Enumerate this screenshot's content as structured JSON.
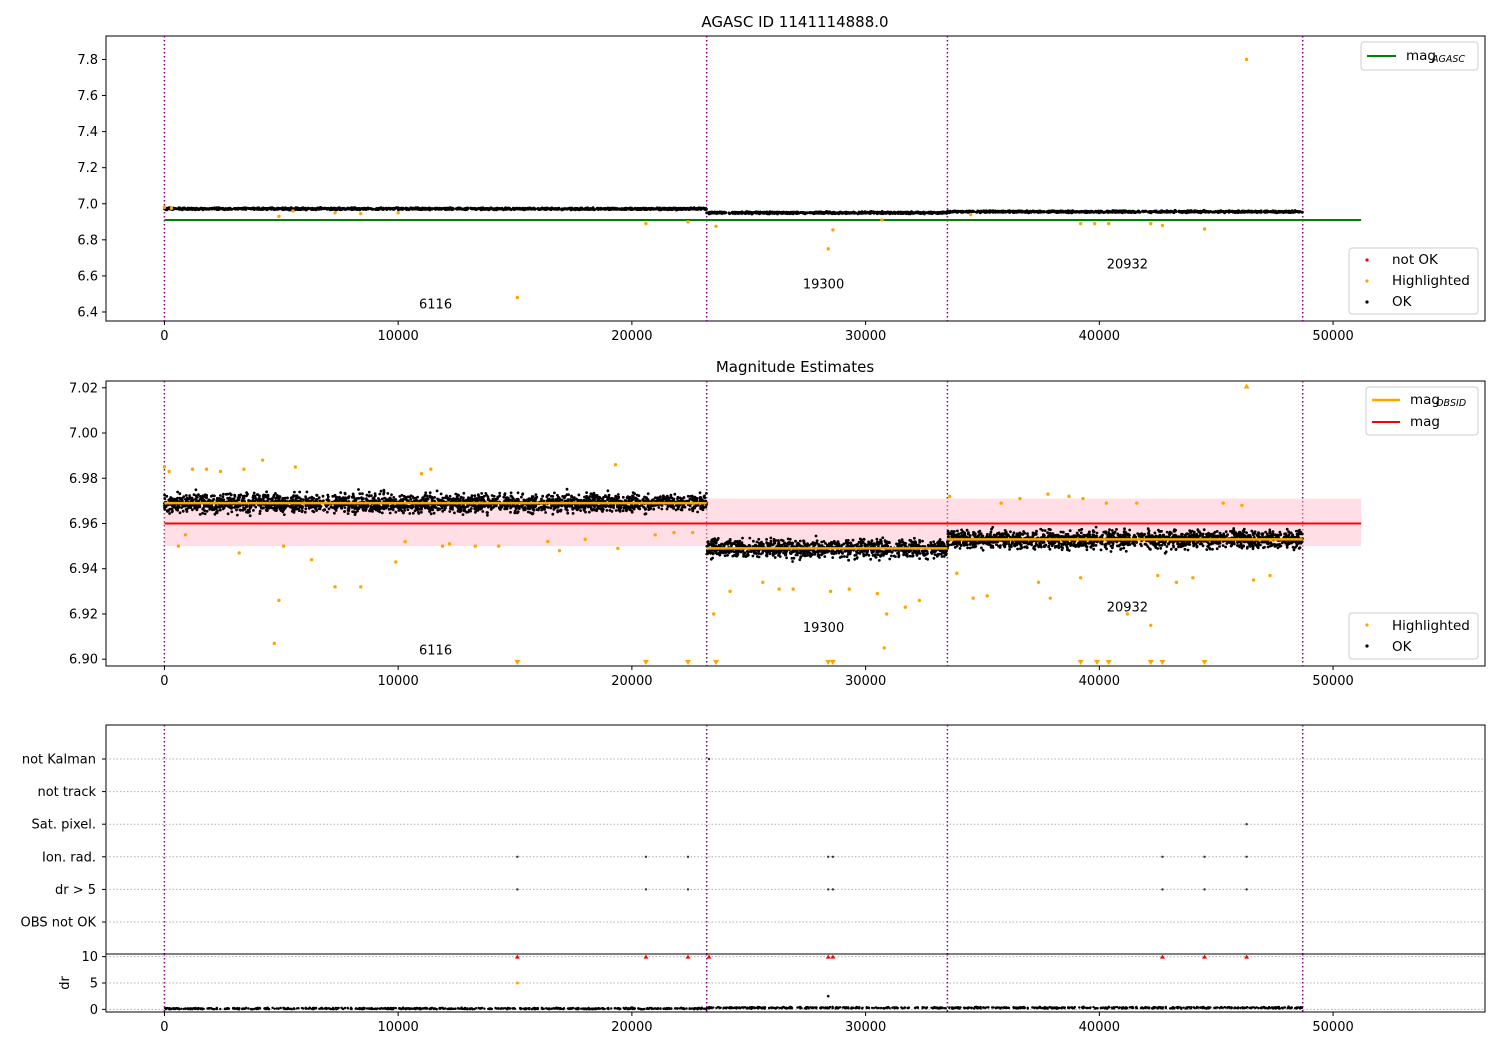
{
  "figure": {
    "panel1_title": "AGASC ID 1141114888.0",
    "panel2_title": "Magnitude Estimates"
  },
  "legends": {
    "mag_agasc": "mag",
    "mag_agasc_sub": "AGASC",
    "mag_obsid": "mag",
    "mag_obsid_sub": "OBSID",
    "mag": "mag",
    "not_ok": "not OK",
    "highlighted": "Highlighted",
    "ok": "OK"
  },
  "colors": {
    "ok": "#000000",
    "highlighted": "#ffa500",
    "not_ok": "#ff0000",
    "mag_agasc_line": "#008000",
    "mag_line": "#ff0000",
    "mag_band": "#ffc0cb",
    "obsid_line": "#ffa500",
    "obsid_boundary": "#800080"
  },
  "chart_data": [
    {
      "type": "scatter",
      "title": "AGASC ID 1141114888.0",
      "xlim": [
        -2500,
        56500
      ],
      "ylim": [
        6.35,
        7.93
      ],
      "xticks": [
        0,
        10000,
        20000,
        30000,
        40000,
        50000
      ],
      "yticks": [
        6.4,
        6.6,
        6.8,
        7.0,
        7.2,
        7.4,
        7.6,
        7.8
      ],
      "obsid_boundaries": [
        0,
        23200,
        33500,
        48700
      ],
      "obsid_labels": [
        {
          "text": "6116",
          "x": 11600,
          "y": 6.42
        },
        {
          "text": "19300",
          "x": 28200,
          "y": 6.53
        },
        {
          "text": "20932",
          "x": 41200,
          "y": 6.64
        }
      ],
      "mag_agasc": 6.91,
      "mag_agasc_x_range": [
        0,
        51200
      ],
      "ok_segments": [
        {
          "x0": 0,
          "x1": 23200,
          "y": 6.972,
          "spread": 0.01
        },
        {
          "x0": 23200,
          "x1": 33500,
          "y": 6.95,
          "spread": 0.01
        },
        {
          "x0": 33500,
          "x1": 48700,
          "y": 6.956,
          "spread": 0.01
        }
      ],
      "highlighted_points": [
        [
          0,
          6.98
        ],
        [
          300,
          6.975
        ],
        [
          4900,
          6.93
        ],
        [
          5500,
          6.96
        ],
        [
          7300,
          6.95
        ],
        [
          8400,
          6.945
        ],
        [
          10000,
          6.95
        ],
        [
          15100,
          6.48
        ],
        [
          20600,
          6.89
        ],
        [
          22400,
          6.9
        ],
        [
          23600,
          6.875
        ],
        [
          28400,
          6.75
        ],
        [
          28600,
          6.855
        ],
        [
          30700,
          6.91
        ],
        [
          34500,
          6.94
        ],
        [
          39200,
          6.89
        ],
        [
          39800,
          6.89
        ],
        [
          40400,
          6.89
        ],
        [
          42200,
          6.89
        ],
        [
          42700,
          6.88
        ],
        [
          44500,
          6.86
        ],
        [
          46300,
          7.8
        ]
      ],
      "legend": [
        "mag_AGASC",
        "not OK",
        "Highlighted",
        "OK"
      ]
    },
    {
      "type": "scatter",
      "title": "Magnitude Estimates",
      "xlim": [
        -2500,
        56500
      ],
      "ylim": [
        6.897,
        7.023
      ],
      "xticks": [
        0,
        10000,
        20000,
        30000,
        40000,
        50000
      ],
      "yticks": [
        6.9,
        6.92,
        6.94,
        6.96,
        6.98,
        7.0,
        7.02
      ],
      "obsid_boundaries": [
        0,
        23200,
        33500,
        48700
      ],
      "obsid_labels": [
        {
          "text": "6116",
          "x": 11600,
          "y": 6.902
        },
        {
          "text": "19300",
          "x": 28200,
          "y": 6.912
        },
        {
          "text": "20932",
          "x": 41200,
          "y": 6.921
        }
      ],
      "mag": 6.96,
      "mag_band": [
        6.95,
        6.971
      ],
      "mag_x_range": [
        0,
        51200
      ],
      "mag_obsid": [
        {
          "x0": 0,
          "x1": 23200,
          "y": 6.969
        },
        {
          "x0": 23200,
          "x1": 33500,
          "y": 6.949
        },
        {
          "x0": 33500,
          "x1": 48700,
          "y": 6.953
        }
      ],
      "ok_segments": [
        {
          "x0": 0,
          "x1": 23200,
          "y": 6.969,
          "spread": 0.008
        },
        {
          "x0": 23200,
          "x1": 33500,
          "y": 6.949,
          "spread": 0.008
        },
        {
          "x0": 33500,
          "x1": 48700,
          "y": 6.953,
          "spread": 0.008
        }
      ],
      "highlighted_points": [
        [
          0,
          6.985
        ],
        [
          200,
          6.983
        ],
        [
          600,
          6.95
        ],
        [
          900,
          6.955
        ],
        [
          1200,
          6.984
        ],
        [
          1800,
          6.984
        ],
        [
          2400,
          6.983
        ],
        [
          3200,
          6.947
        ],
        [
          3400,
          6.984
        ],
        [
          4200,
          6.988
        ],
        [
          4700,
          6.907
        ],
        [
          4900,
          6.926
        ],
        [
          5100,
          6.95
        ],
        [
          5600,
          6.985
        ],
        [
          6300,
          6.944
        ],
        [
          7300,
          6.932
        ],
        [
          8400,
          6.932
        ],
        [
          9900,
          6.943
        ],
        [
          10300,
          6.952
        ],
        [
          11000,
          6.982
        ],
        [
          11400,
          6.984
        ],
        [
          11900,
          6.95
        ],
        [
          12200,
          6.951
        ],
        [
          13300,
          6.95
        ],
        [
          14300,
          6.95
        ],
        [
          16400,
          6.952
        ],
        [
          16900,
          6.948
        ],
        [
          18000,
          6.953
        ],
        [
          19300,
          6.986
        ],
        [
          19400,
          6.949
        ],
        [
          21000,
          6.955
        ],
        [
          21800,
          6.956
        ],
        [
          22600,
          6.956
        ],
        [
          23500,
          6.92
        ],
        [
          24200,
          6.93
        ],
        [
          25600,
          6.934
        ],
        [
          26300,
          6.931
        ],
        [
          26900,
          6.931
        ],
        [
          28500,
          6.93
        ],
        [
          29300,
          6.931
        ],
        [
          30500,
          6.929
        ],
        [
          30900,
          6.92
        ],
        [
          31700,
          6.923
        ],
        [
          32300,
          6.926
        ],
        [
          30800,
          6.905
        ],
        [
          33600,
          6.972
        ],
        [
          33900,
          6.938
        ],
        [
          34600,
          6.927
        ],
        [
          35200,
          6.928
        ],
        [
          35800,
          6.969
        ],
        [
          36600,
          6.971
        ],
        [
          37400,
          6.934
        ],
        [
          37900,
          6.927
        ],
        [
          37800,
          6.973
        ],
        [
          38700,
          6.972
        ],
        [
          39300,
          6.971
        ],
        [
          39200,
          6.936
        ],
        [
          40300,
          6.969
        ],
        [
          41200,
          6.92
        ],
        [
          41600,
          6.969
        ],
        [
          42200,
          6.915
        ],
        [
          42500,
          6.937
        ],
        [
          43300,
          6.934
        ],
        [
          44000,
          6.936
        ],
        [
          45300,
          6.969
        ],
        [
          46100,
          6.968
        ],
        [
          46300,
          7.022
        ],
        [
          46600,
          6.935
        ],
        [
          47300,
          6.937
        ]
      ],
      "clipped_low_points_x": [
        15100,
        20600,
        22400,
        23600,
        28400,
        28600,
        39200,
        39900,
        40400,
        42200,
        42700,
        44500
      ],
      "legend": [
        "mag_OBSID",
        "mag",
        "Highlighted",
        "OK"
      ]
    },
    {
      "type": "scatter",
      "title": "",
      "xlim": [
        -2500,
        56500
      ],
      "xticks": [
        0,
        10000,
        20000,
        30000,
        40000,
        50000
      ],
      "categories": [
        "not Kalman",
        "not track",
        "Sat. pixel.",
        "Ion. rad.",
        "dr > 5",
        "OBS not OK"
      ],
      "obsid_boundaries": [
        0,
        23200,
        33500,
        48700
      ],
      "flag_points": [
        {
          "category": "not Kalman",
          "x": 23300
        },
        {
          "category": "Sat. pixel.",
          "x": 46300
        },
        {
          "category": "Ion. rad.",
          "x": 15100
        },
        {
          "category": "Ion. rad.",
          "x": 20600
        },
        {
          "category": "Ion. rad.",
          "x": 22400
        },
        {
          "category": "Ion. rad.",
          "x": 28400
        },
        {
          "category": "Ion. rad.",
          "x": 28600
        },
        {
          "category": "Ion. rad.",
          "x": 42700
        },
        {
          "category": "Ion. rad.",
          "x": 44500
        },
        {
          "category": "Ion. rad.",
          "x": 46300
        },
        {
          "category": "dr > 5",
          "x": 15100
        },
        {
          "category": "dr > 5",
          "x": 20600
        },
        {
          "category": "dr > 5",
          "x": 22400
        },
        {
          "category": "dr > 5",
          "x": 28400
        },
        {
          "category": "dr > 5",
          "x": 28600
        },
        {
          "category": "dr > 5",
          "x": 42700
        },
        {
          "category": "dr > 5",
          "x": 44500
        },
        {
          "category": "dr > 5",
          "x": 46300
        }
      ]
    },
    {
      "type": "scatter",
      "ylabel": "dr",
      "xlim": [
        -2500,
        56500
      ],
      "ylim": [
        -0.5,
        10.5
      ],
      "yticks": [
        0,
        5,
        10
      ],
      "xticks": [
        0,
        10000,
        20000,
        30000,
        40000,
        50000
      ],
      "obsid_boundaries": [
        0,
        23200,
        33500,
        48700
      ],
      "baseline_segments": [
        {
          "x0": 0,
          "x1": 23200,
          "y": 0.15
        },
        {
          "x0": 23200,
          "x1": 33500,
          "y": 0.3
        },
        {
          "x0": 33500,
          "x1": 48700,
          "y": 0.3
        }
      ],
      "clipped_high_points": [
        {
          "x": 15100,
          "y": 10
        },
        {
          "x": 20600,
          "y": 10
        },
        {
          "x": 22400,
          "y": 10
        },
        {
          "x": 23300,
          "y": 10
        },
        {
          "x": 28400,
          "y": 10
        },
        {
          "x": 28600,
          "y": 10
        },
        {
          "x": 42700,
          "y": 10
        },
        {
          "x": 44500,
          "y": 10
        },
        {
          "x": 46300,
          "y": 10
        }
      ],
      "highlighted_points": [
        [
          15100,
          5
        ]
      ],
      "ok_points": [
        [
          28400,
          2.5
        ]
      ]
    }
  ]
}
